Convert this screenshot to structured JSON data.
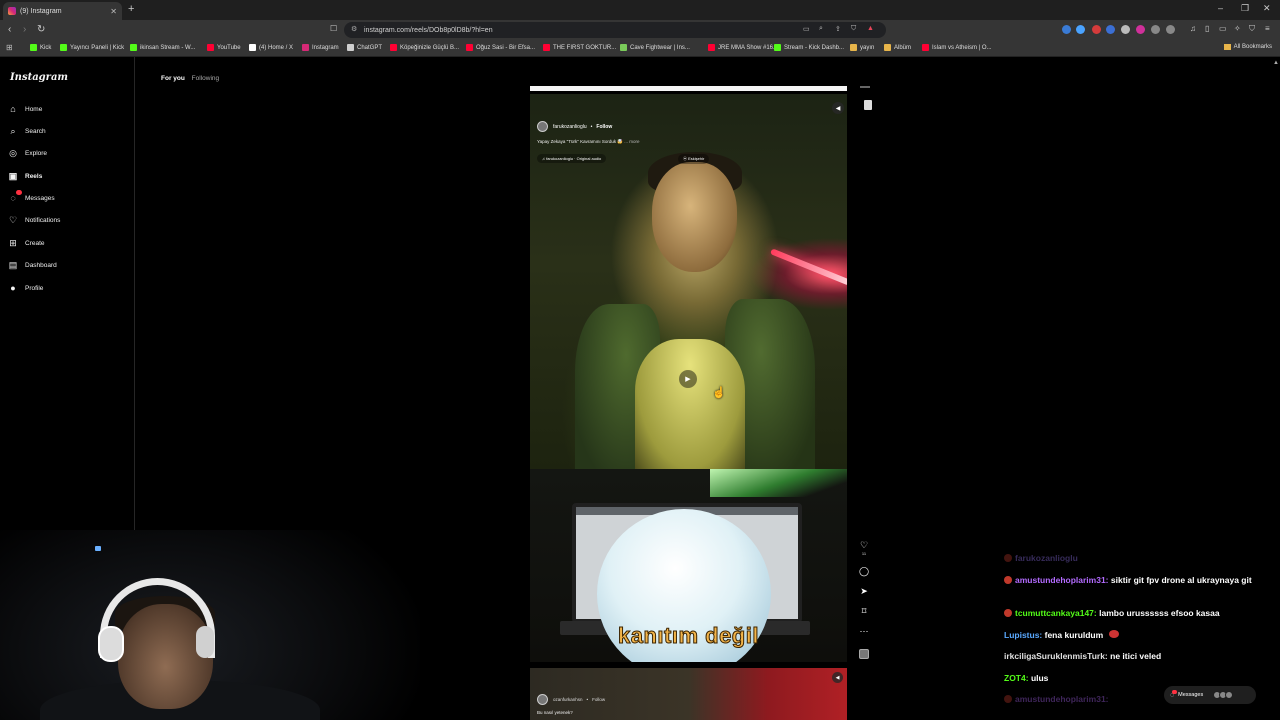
{
  "browser": {
    "tab_title": "(9) Instagram",
    "new_tab_glyph": "+",
    "url": "instagram.com/reels/DOb8p0lD8b/?hl=en",
    "bookmarks": [
      {
        "label": "Kick",
        "color": "#53fc18"
      },
      {
        "label": "Yayıncı Paneli | Kick",
        "color": "#53fc18"
      },
      {
        "label": "ikinsan Stream - W...",
        "color": "#53fc18"
      },
      {
        "label": "YouTube",
        "color": "#ff0033"
      },
      {
        "label": "(4) Home / X",
        "color": "#ffffff"
      },
      {
        "label": "Instagram",
        "color": "#d62976"
      },
      {
        "label": "ChatGPT",
        "color": "#cfcfcf"
      },
      {
        "label": "Köpeğinizle Güçlü B...",
        "color": "#ff0033"
      },
      {
        "label": "Oğuz Sasi - Bir Efsa...",
        "color": "#ff0033"
      },
      {
        "label": "THE FIRST GOKTUR...",
        "color": "#ff0033"
      },
      {
        "label": "Cave Fightwear | Ins...",
        "color": "#7acb5a"
      },
      {
        "label": "JRE MMA Show #16...",
        "color": "#ff0033"
      },
      {
        "label": "Stream - Kick Dashb...",
        "color": "#53fc18"
      },
      {
        "label": "yayın",
        "color": "#e8b54a"
      },
      {
        "label": "Albüm",
        "color": "#e8b54a"
      },
      {
        "label": "Islam vs Atheism | O...",
        "color": "#ff0033"
      }
    ],
    "all_bookmarks": "All Bookmarks"
  },
  "sidebar": {
    "logo": "Instagram",
    "items": [
      {
        "label": "Home",
        "icon": "home-icon",
        "glyph": "⌂"
      },
      {
        "label": "Search",
        "icon": "search-icon",
        "glyph": "⌕"
      },
      {
        "label": "Explore",
        "icon": "explore-icon",
        "glyph": "◎"
      },
      {
        "label": "Reels",
        "icon": "reels-icon",
        "glyph": "▣"
      },
      {
        "label": "Messages",
        "icon": "messages-icon",
        "glyph": "◌"
      },
      {
        "label": "Notifications",
        "icon": "heart-icon",
        "glyph": "♡"
      },
      {
        "label": "Create",
        "icon": "create-icon",
        "glyph": "⊞"
      },
      {
        "label": "Dashboard",
        "icon": "dashboard-icon",
        "glyph": "▤"
      },
      {
        "label": "Profile",
        "icon": "profile-icon",
        "glyph": "●"
      }
    ]
  },
  "feed_tabs": {
    "for_you": "For you",
    "following": "Following"
  },
  "reel": {
    "username": "farukozanlioglu",
    "separator": "•",
    "follow": "Follow",
    "caption": "Yapay Zekaya \"Türk\" Kavramını Sorduk 🤯",
    "more": "... more",
    "audio": "farukozanlioglu · Original audio",
    "location": "Eskişehir",
    "subtitle": "kanıtım değil",
    "likes": "11"
  },
  "next_reel": {
    "username": "ozanfurkanhsn",
    "follow": "Follow",
    "caption": "Bu nasıl yetenek?"
  },
  "chat": [
    {
      "user": "farukozanlioglu",
      "msg": "",
      "color": "#9b7bff",
      "faded": true
    },
    {
      "user": "amustundehoplarim31:",
      "msg": "siktir git fpv drone al ukraynaya git",
      "color": "#b36bff"
    },
    {
      "user": "tcumuttcankaya147:",
      "msg": "lambo urussssss efsoo kasaa",
      "color": "#53fc18"
    },
    {
      "user": "Lupistus:",
      "msg": "fena kuruldum",
      "color": "#5aa9ff"
    },
    {
      "user": "irkciligaSuruklenmisTurk:",
      "msg": "ne itici veled",
      "color": "#e0e0e0"
    },
    {
      "user": "ZOT4:",
      "msg": "ulus",
      "color": "#53fc18"
    },
    {
      "user": "amustundehoplarim31:",
      "msg": "",
      "color": "#b36bff",
      "faded": true
    }
  ],
  "messages_pill": {
    "label": "Messages"
  }
}
